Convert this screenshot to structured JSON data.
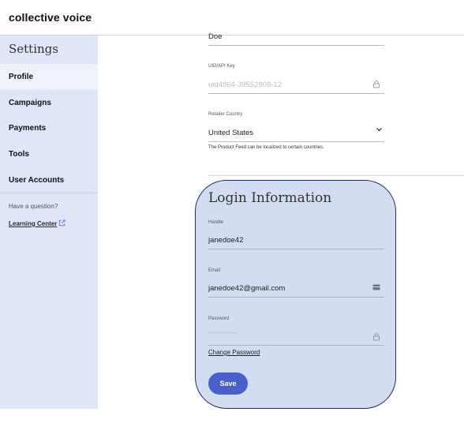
{
  "brand": "collective voice",
  "sidebar": {
    "title": "Settings",
    "items": [
      {
        "label": "Profile",
        "active": true
      },
      {
        "label": "Campaigns"
      },
      {
        "label": "Payments"
      },
      {
        "label": "Tools"
      },
      {
        "label": "User Accounts"
      }
    ],
    "question": "Have a question?",
    "link_label": "Learning Center"
  },
  "profile": {
    "last_name_value": "Doe",
    "uid": {
      "label": "UID/API Key",
      "value": "uid4864-39552808-12"
    },
    "country": {
      "label": "Retailer Country",
      "value": "United States",
      "hint": "The Product Feed can be localized to certain countries."
    }
  },
  "login": {
    "title": "Login Information",
    "handle": {
      "label": "Handle",
      "value": "janedoe42"
    },
    "email": {
      "label": "Email",
      "value": "janedoe42@gmail.com"
    },
    "password": {
      "label": "Password",
      "value": "••••••••••••••"
    },
    "change_password": "Change Password",
    "save": "Save"
  },
  "colors": {
    "accent": "#4860c9",
    "sidebar_bg": "#dfe6f8",
    "card_bg": "#d3ddf2",
    "card_border": "#1e2d6b"
  }
}
